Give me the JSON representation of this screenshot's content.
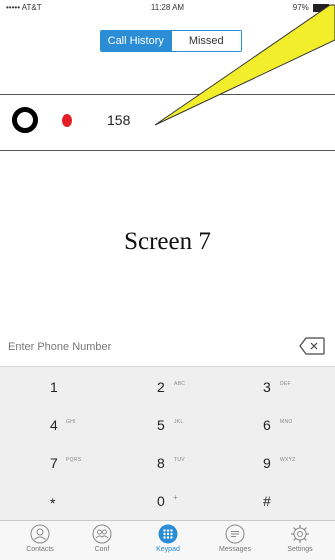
{
  "status_bar": {
    "carrier": "••••• AT&T",
    "time": "11:28 AM",
    "battery": "97%"
  },
  "segmented": {
    "tab_history": "Call History",
    "tab_missed": "Missed",
    "active": "Call History"
  },
  "call_history": [
    {
      "number": "158"
    }
  ],
  "annotation": {
    "label": "Screen 7"
  },
  "keypad": {
    "placeholder": "Enter Phone Number",
    "keys": [
      {
        "digit": "1",
        "letters": ""
      },
      {
        "digit": "2",
        "letters": "ABC"
      },
      {
        "digit": "3",
        "letters": "DEF"
      },
      {
        "digit": "4",
        "letters": "GHI"
      },
      {
        "digit": "5",
        "letters": "JKL"
      },
      {
        "digit": "6",
        "letters": "MNO"
      },
      {
        "digit": "7",
        "letters": "PQRS"
      },
      {
        "digit": "8",
        "letters": "TUV"
      },
      {
        "digit": "9",
        "letters": "WXYZ"
      },
      {
        "digit": "*",
        "letters": ""
      },
      {
        "digit": "0",
        "letters": "+"
      },
      {
        "digit": "#",
        "letters": ""
      }
    ]
  },
  "tabbar": {
    "items": [
      {
        "label": "Contacts",
        "icon": "contacts-icon"
      },
      {
        "label": "Conf",
        "icon": "conference-icon"
      },
      {
        "label": "Keypad",
        "icon": "keypad-icon",
        "active": true
      },
      {
        "label": "Messages",
        "icon": "messages-icon"
      },
      {
        "label": "Settings",
        "icon": "settings-icon"
      }
    ]
  },
  "colors": {
    "accent": "#2a8dd6",
    "missed_dot": "#e51d24",
    "callout": "#f2ee2c"
  }
}
